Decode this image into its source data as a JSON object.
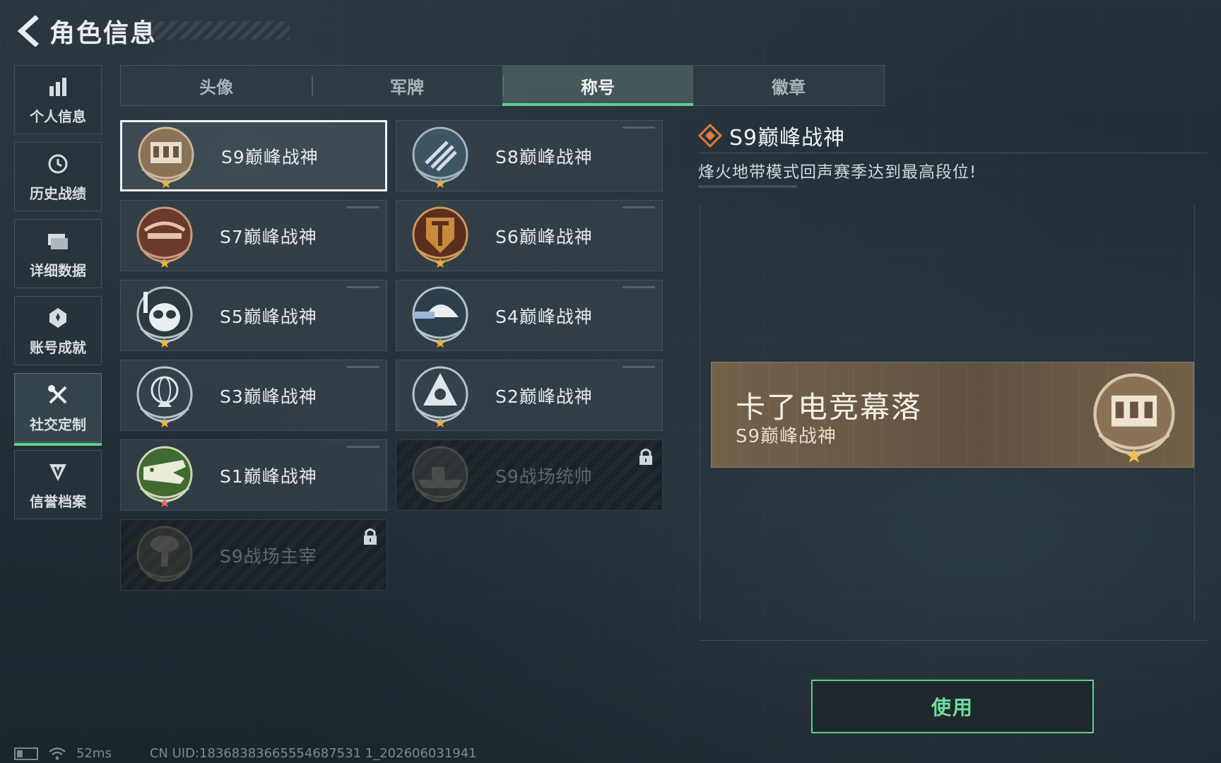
{
  "header": {
    "title": "角色信息"
  },
  "sidebar": {
    "items": [
      {
        "label": "个人信息",
        "icon": "bar-chart-icon"
      },
      {
        "label": "历史战绩",
        "icon": "history-icon"
      },
      {
        "label": "详细数据",
        "icon": "folder-icon"
      },
      {
        "label": "账号成就",
        "icon": "achievement-icon"
      },
      {
        "label": "社交定制",
        "icon": "tools-icon",
        "active": true
      },
      {
        "label": "信誉档案",
        "icon": "reputation-icon"
      }
    ]
  },
  "tabs": [
    {
      "label": "头像"
    },
    {
      "label": "军牌"
    },
    {
      "label": "称号",
      "active": true
    },
    {
      "label": "徽章"
    }
  ],
  "titles": [
    {
      "name": "S9巅峰战神",
      "icon": "dam-gate-emblem-icon",
      "selected": true,
      "locked": false
    },
    {
      "name": "S8巅峰战神",
      "icon": "blue-stripes-emblem-icon",
      "selected": false,
      "locked": false
    },
    {
      "name": "S7巅峰战神",
      "icon": "crossbow-emblem-icon",
      "selected": false,
      "locked": false
    },
    {
      "name": "S6巅峰战神",
      "icon": "shield-t-emblem-icon",
      "selected": false,
      "locked": false
    },
    {
      "name": "S5巅峰战神",
      "icon": "diver-skull-emblem-icon",
      "selected": false,
      "locked": false
    },
    {
      "name": "S4巅峰战神",
      "icon": "helmet-nvg-emblem-icon",
      "selected": false,
      "locked": false
    },
    {
      "name": "S3巅峰战神",
      "icon": "globe-emblem-icon",
      "selected": false,
      "locked": false
    },
    {
      "name": "S2巅峰战神",
      "icon": "triangle-emblem-icon",
      "selected": false,
      "locked": false
    },
    {
      "name": "S1巅峰战神",
      "icon": "crocodile-emblem-icon",
      "selected": false,
      "locked": false
    },
    {
      "name": "S9战场统帅",
      "icon": "warship-emblem-icon",
      "selected": false,
      "locked": true
    },
    {
      "name": "S9战场主宰",
      "icon": "mushroom-cloud-emblem-icon",
      "selected": false,
      "locked": true
    }
  ],
  "detail": {
    "title": "S9巅峰战神",
    "description": "烽火地带模式回声赛季达到最高段位!"
  },
  "preview": {
    "player_name": "卡了电竞幕落",
    "title": "S9巅峰战神"
  },
  "actions": {
    "use_label": "使用"
  },
  "footer": {
    "ping": "52ms",
    "uid": "CN UID:18368383665554687531 1_202606031941"
  },
  "colors": {
    "accent_green": "#5cd08a",
    "selected_border": "#eef2f3",
    "title_diamond": "#e07a3c",
    "banner_bronze": "#786449"
  }
}
